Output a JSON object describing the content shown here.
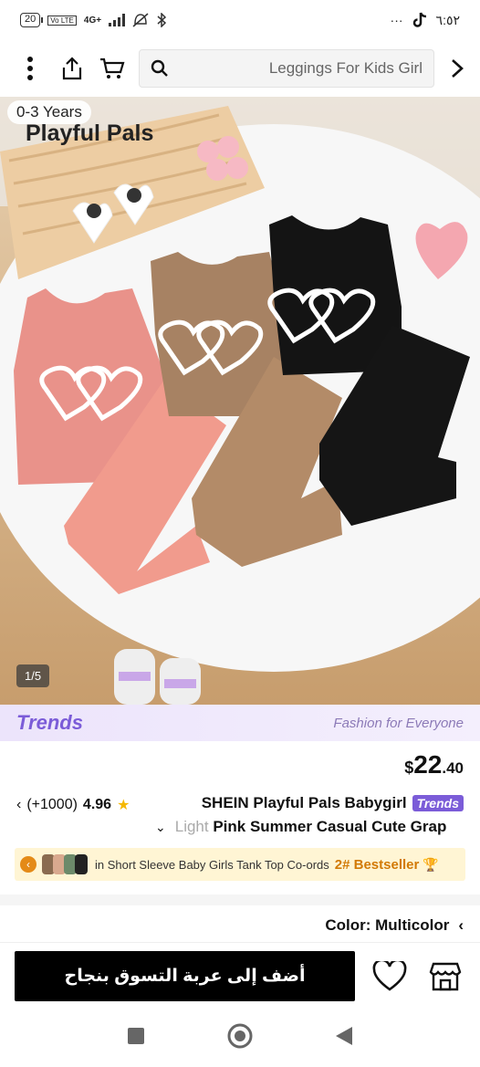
{
  "status_bar": {
    "battery": "20",
    "network_labels": "Vo LTE",
    "network_type": "4G+",
    "time": "٦:٥٢",
    "more": "···"
  },
  "top_nav": {
    "search_text": "Leggings For Kids Girl",
    "icons": [
      "more-vertical-icon",
      "share-icon",
      "cart-icon",
      "search-icon",
      "chevron-right-icon"
    ]
  },
  "product_image": {
    "size_tag": "0-3 Years",
    "brand_text": "Playful Pals",
    "page_indicator": "1/5"
  },
  "trends_banner": {
    "logo": "Trends",
    "tagline": "Fashion for Everyone"
  },
  "price": {
    "currency": "$",
    "main": "22",
    "cents": ".40"
  },
  "rating": {
    "count": "(+1000)",
    "score": "4.96"
  },
  "title": {
    "line1": "SHEIN Playful Pals Babygirl",
    "badge": "Trends",
    "line2_faded": "Light",
    "line2": " Pink Summer Casual Cute Grap"
  },
  "bestseller": {
    "text": "in Short Sleeve Baby Girls Tank Top Co-ords",
    "rank": "2# Bestseller"
  },
  "color_row": {
    "label": "Color: Multicolor"
  },
  "bottom_bar": {
    "add_to_cart": "أضف إلى عربة التسوق بنجاح"
  },
  "colors": {
    "trends_purple": "#7b5cd8",
    "bestseller_bg": "#fff5d4",
    "bestseller_accent": "#d27a06",
    "star": "#f5b800",
    "cart_button": "#000000",
    "pink_set": "#e9928a",
    "tan_set": "#a78263",
    "black_set": "#141414"
  }
}
